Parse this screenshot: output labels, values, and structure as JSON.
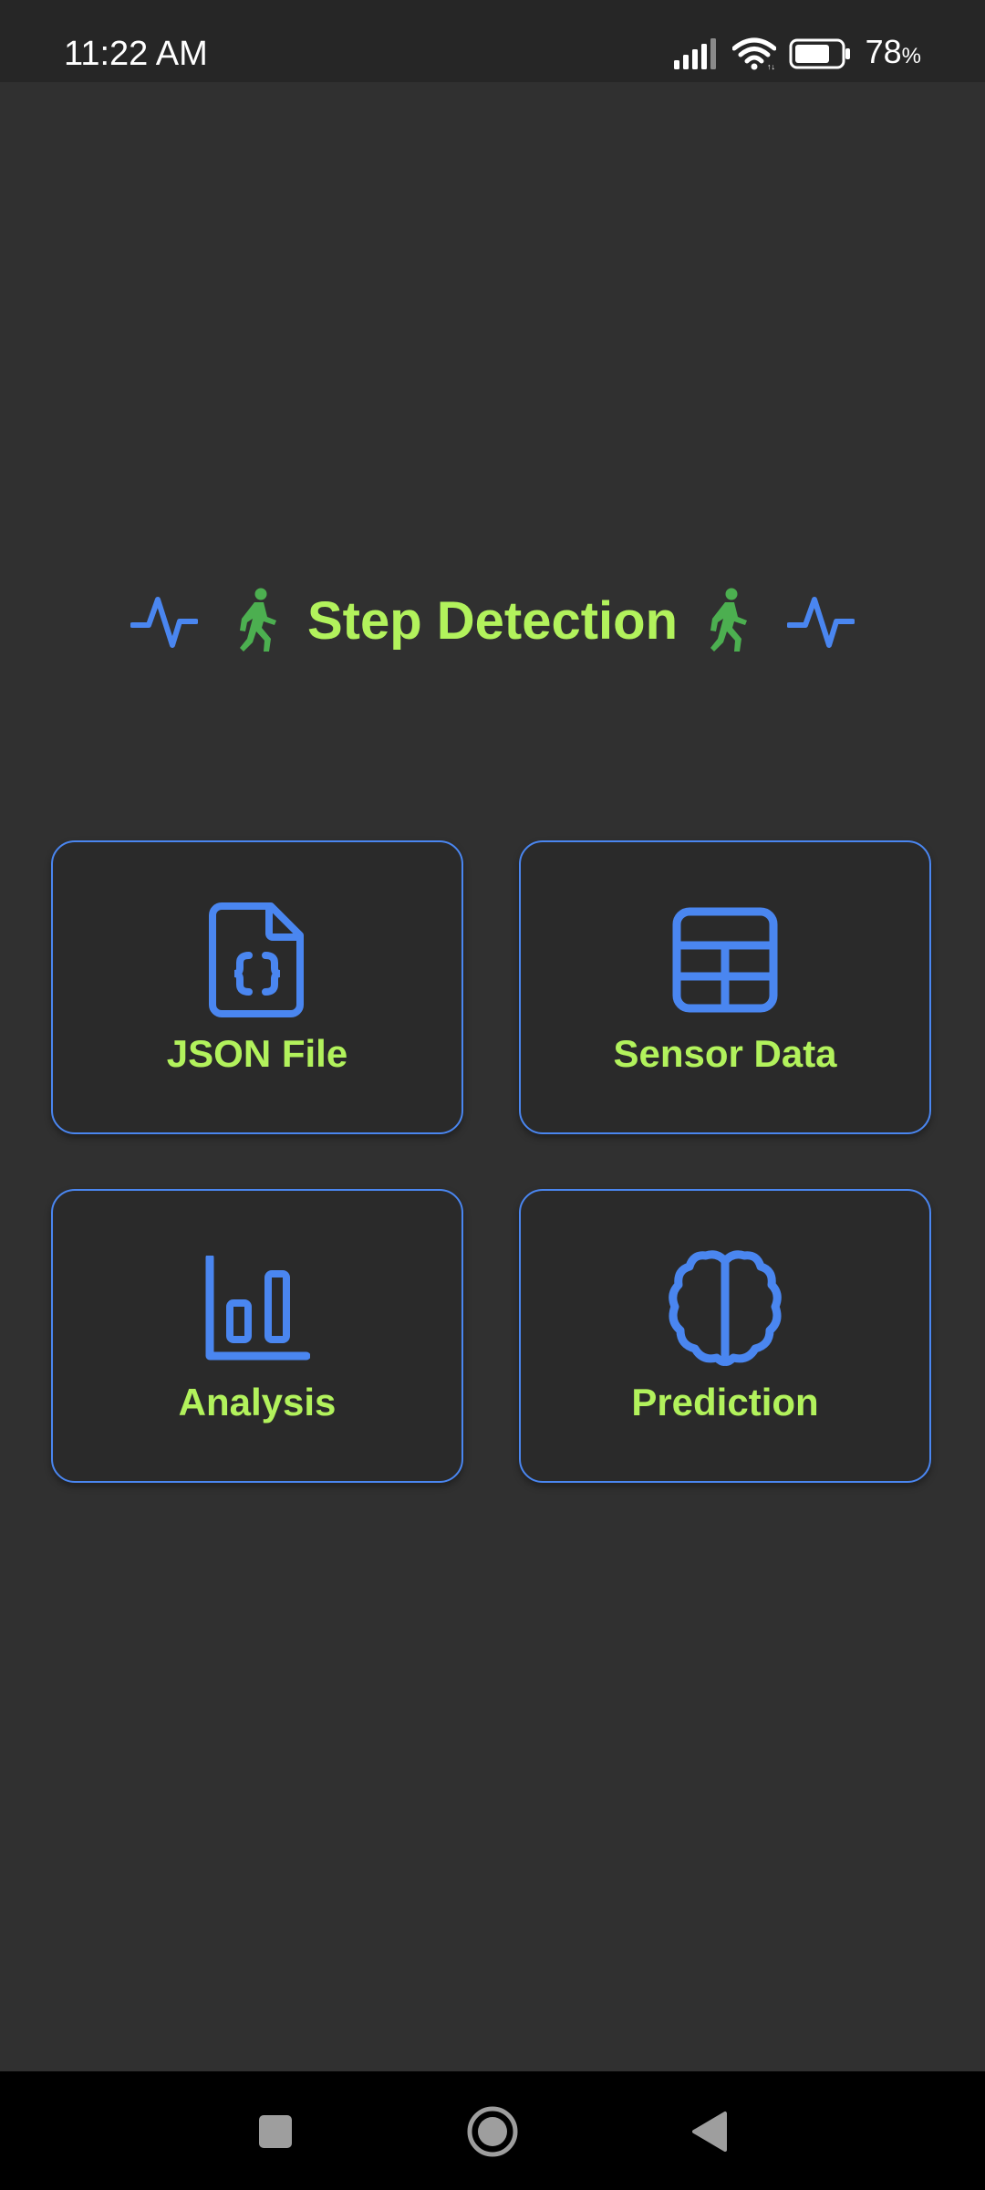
{
  "status_bar": {
    "time": "11:22 AM",
    "battery_percent": "78",
    "battery_unit": "%",
    "battery_level": 0.78,
    "icons": [
      "signal-icon",
      "wifi-icon",
      "battery-icon"
    ]
  },
  "header": {
    "title": "Step Detection",
    "icons": [
      "pulse-icon",
      "walking-person-icon",
      "walking-person-icon",
      "pulse-icon"
    ]
  },
  "cards": [
    {
      "label": "JSON File",
      "icon": "json-file-icon"
    },
    {
      "label": "Sensor Data",
      "icon": "table-grid-icon"
    },
    {
      "label": "Analysis",
      "icon": "bar-chart-icon"
    },
    {
      "label": "Prediction",
      "icon": "brain-icon"
    }
  ],
  "nav_bar": {
    "buttons": [
      "recents-icon",
      "home-icon",
      "back-icon"
    ]
  },
  "colors": {
    "accent_green": "#b2f25c",
    "accent_blue": "#4a86f0",
    "walker_green": "#4caf50",
    "background": "#303030"
  }
}
